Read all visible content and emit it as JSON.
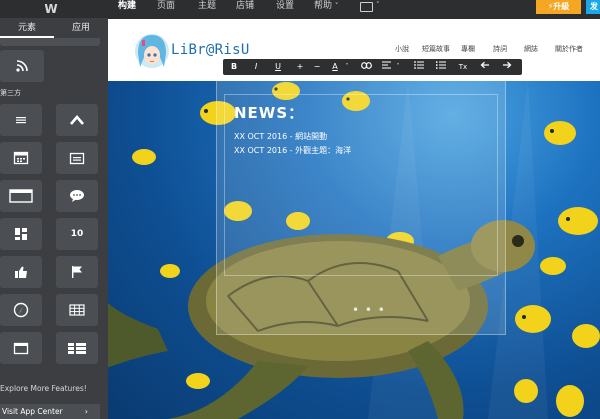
{
  "sidebar": {
    "tabs": [
      {
        "label": "元素",
        "active": true
      },
      {
        "label": "应用",
        "active": false
      }
    ],
    "section_label": "第三方",
    "tiles": [
      {
        "icon": "rss-icon"
      },
      {
        "icon": "menu-lines-icon"
      },
      {
        "icon": "chevron-up-icon"
      },
      {
        "icon": "calendar-icon"
      },
      {
        "icon": "embed-window-icon"
      },
      {
        "icon": "rectangle-icon"
      },
      {
        "icon": "chat-bubble-icon"
      },
      {
        "icon": "grid-blocks-icon"
      },
      {
        "icon": "counter-icon",
        "text": "10"
      },
      {
        "icon": "thumbs-up-icon"
      },
      {
        "icon": "flag-icon"
      },
      {
        "icon": "compass-icon"
      },
      {
        "icon": "table-icon"
      },
      {
        "icon": "window-icon"
      },
      {
        "icon": "list-columns-icon"
      }
    ],
    "explore_text": "Explore More Features!",
    "visit_button": "Visit App Center",
    "visit_arrow": "›"
  },
  "topbar": {
    "tabs": [
      "构建",
      "页面",
      "主题",
      "店铺",
      "设置",
      "帮助"
    ],
    "active_tab": "构建",
    "help_caret": "˅",
    "upgrade_label": "⚡升級",
    "publish_label": "发"
  },
  "site": {
    "title": "LiBr@RisU",
    "nav": [
      "小說",
      "短篇故事",
      "專欄",
      "詩詞",
      "網誌",
      "關於作者"
    ]
  },
  "toolbar": {
    "bold": "B",
    "italic": "I",
    "underline": "U",
    "font_up": "+",
    "font_down": "−",
    "color": "A",
    "clear_format": "Tx"
  },
  "news": {
    "title": "NEWS：",
    "lines": [
      "XX OCT 2016 - 網站開動",
      "XX OCT 2016 - 外觀主題：海洋"
    ],
    "more_dots": "• • •"
  },
  "colors": {
    "upgrade": "#f5a623",
    "publish": "#1aa7e8",
    "site_title": "#1d6fb0",
    "sidebar_bg": "#3c3e41"
  }
}
